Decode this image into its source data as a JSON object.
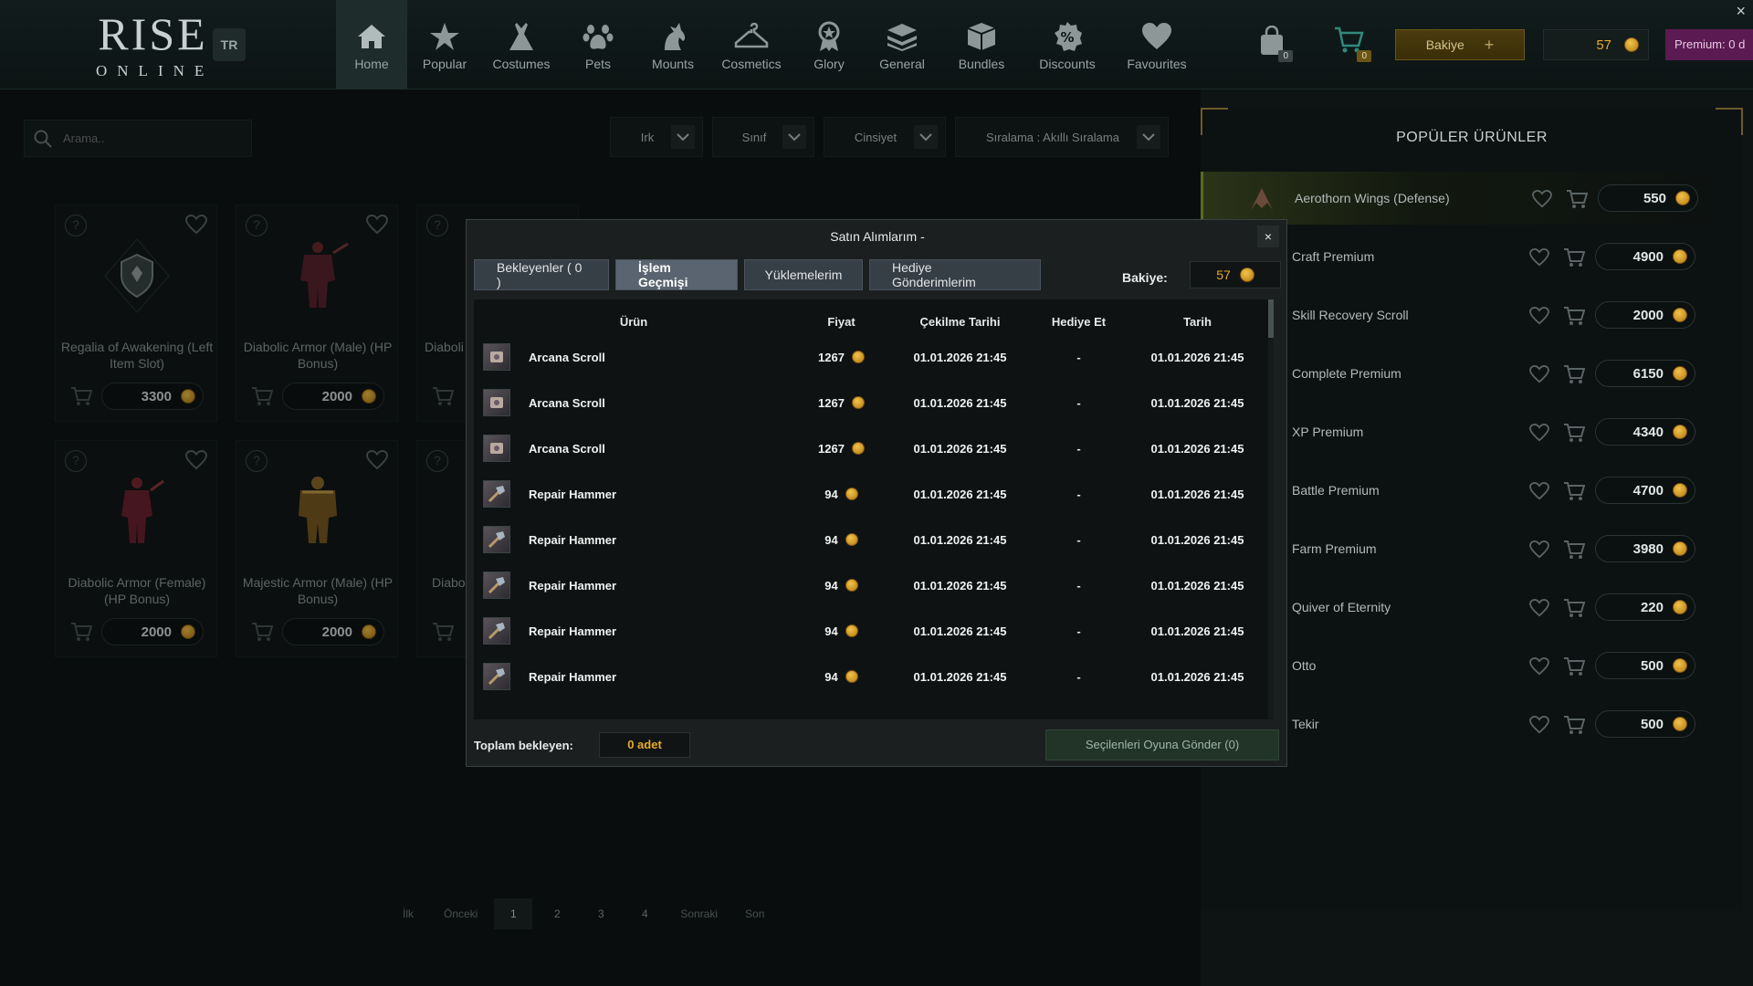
{
  "app": {
    "logo_main": "RISE",
    "logo_sub": "ONLINE",
    "lang": "TR"
  },
  "nav": [
    {
      "label": "Home",
      "icon": "home-icon"
    },
    {
      "label": "Popular",
      "icon": "star-icon"
    },
    {
      "label": "Costumes",
      "icon": "costume-icon"
    },
    {
      "label": "Pets",
      "icon": "paw-icon"
    },
    {
      "label": "Mounts",
      "icon": "horse-icon"
    },
    {
      "label": "Cosmetics",
      "icon": "hanger-icon"
    },
    {
      "label": "Glory",
      "icon": "medal-icon"
    },
    {
      "label": "General",
      "icon": "layers-icon"
    },
    {
      "label": "Bundles",
      "icon": "bundle-icon"
    },
    {
      "label": "Discounts",
      "icon": "percent-icon"
    },
    {
      "label": "Favourites",
      "icon": "heart-icon"
    }
  ],
  "header": {
    "bag_count": "0",
    "cart_count": "0",
    "bakiye_label": "Bakiye",
    "balance": "57",
    "premium_label": "Premium: 0 d",
    "close_label": "×"
  },
  "filters": {
    "search_placeholder": "Arama..",
    "irk": "Irk",
    "sinif": "Sınıf",
    "cinsiyet": "Cinsiyet",
    "siralama": "Sıralama : Akıllı Sıralama"
  },
  "products": [
    {
      "name": "Regalia of Awakening (Left Item Slot)",
      "price": "3300"
    },
    {
      "name": "Diabolic Armor (Male) (HP Bonus)",
      "price": "2000"
    },
    {
      "name": "Diaboli",
      "price": ""
    },
    {
      "name": "Diabolic Armor (Female) (HP Bonus)",
      "price": "2000"
    },
    {
      "name": "Majestic Armor (Male) (HP Bonus)",
      "price": "2000"
    },
    {
      "name": "Diabo",
      "price": ""
    }
  ],
  "pager": {
    "first": "İlk",
    "prev": "Önceki",
    "pages": [
      "1",
      "2",
      "3",
      "4"
    ],
    "next": "Sonraki",
    "last": "Son"
  },
  "popular": {
    "title": "POPÜLER ÜRÜNLER",
    "items": [
      {
        "name": "Aerothorn Wings (Defense)",
        "price": "550"
      },
      {
        "name": "Craft Premium",
        "price": "4900"
      },
      {
        "name": "Skill Recovery Scroll",
        "price": "2000"
      },
      {
        "name": "Complete Premium",
        "price": "6150"
      },
      {
        "name": "XP Premium",
        "price": "4340"
      },
      {
        "name": "Battle Premium",
        "price": "4700"
      },
      {
        "name": "Farm Premium",
        "price": "3980"
      },
      {
        "name": "Quiver of Eternity",
        "price": "220"
      },
      {
        "name": "Otto",
        "price": "500"
      },
      {
        "name": "Tekir",
        "price": "500"
      }
    ]
  },
  "modal": {
    "title": "Satın Alımlarım -",
    "close": "×",
    "tabs": [
      {
        "label": "Bekleyenler ( 0 )"
      },
      {
        "label": "İşlem Geçmişi"
      },
      {
        "label": "Yüklemelerim"
      },
      {
        "label": "Hediye Gönderimlerim"
      }
    ],
    "balance_label": "Bakiye:",
    "balance": "57",
    "columns": [
      "Ürün",
      "Fiyat",
      "Çekilme Tarihi",
      "Hediye Et",
      "Tarih"
    ],
    "rows": [
      {
        "item": "Arcana Scroll",
        "price": "1267",
        "drawn": "01.01.2026 21:45",
        "gift": "-",
        "date": "01.01.2026 21:45"
      },
      {
        "item": "Arcana Scroll",
        "price": "1267",
        "drawn": "01.01.2026 21:45",
        "gift": "-",
        "date": "01.01.2026 21:45"
      },
      {
        "item": "Arcana Scroll",
        "price": "1267",
        "drawn": "01.01.2026 21:45",
        "gift": "-",
        "date": "01.01.2026 21:45"
      },
      {
        "item": "Repair Hammer",
        "price": "94",
        "drawn": "01.01.2026 21:45",
        "gift": "-",
        "date": "01.01.2026 21:45"
      },
      {
        "item": "Repair Hammer",
        "price": "94",
        "drawn": "01.01.2026 21:45",
        "gift": "-",
        "date": "01.01.2026 21:45"
      },
      {
        "item": "Repair Hammer",
        "price": "94",
        "drawn": "01.01.2026 21:45",
        "gift": "-",
        "date": "01.01.2026 21:45"
      },
      {
        "item": "Repair Hammer",
        "price": "94",
        "drawn": "01.01.2026 21:45",
        "gift": "-",
        "date": "01.01.2026 21:45"
      },
      {
        "item": "Repair Hammer",
        "price": "94",
        "drawn": "01.01.2026 21:45",
        "gift": "-",
        "date": "01.01.2026 21:45"
      }
    ],
    "footer_label": "Toplam bekleyen:",
    "footer_count": "0 adet",
    "send_label": "Seçilenleri Oyuna Gönder (0)"
  },
  "colors": {
    "accent_gold": "#e7a92a",
    "premium": "#5b1a52",
    "modal_bg": "#1b1f1f"
  }
}
